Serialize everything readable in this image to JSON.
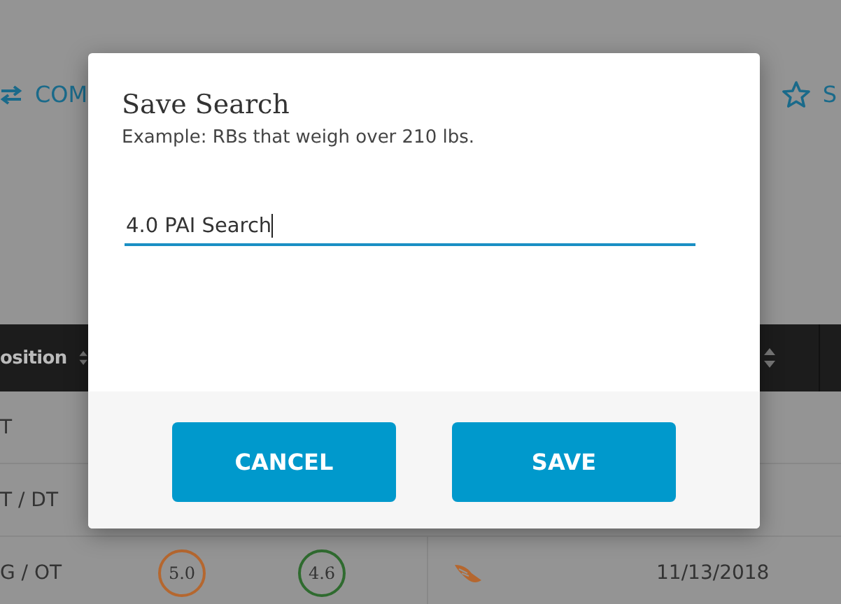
{
  "toolbar": [
    {
      "kind": "swap",
      "label": "COM"
    },
    {
      "kind": "star",
      "label": "S"
    }
  ],
  "table": {
    "columns": [
      {
        "label": "osition",
        "sortable": true
      },
      {
        "sortable": true
      }
    ],
    "rows": [
      {
        "position": "T"
      },
      {
        "position": "T / DT"
      },
      {
        "position": "G / OT",
        "scores": [
          {
            "value": "5.0",
            "color": "#b5672f"
          },
          {
            "value": "4.6",
            "color": "#2f6b2f"
          }
        ],
        "date": "11/13/2018"
      }
    ]
  },
  "dialog": {
    "title": "Save Search",
    "hint": "Example: RBs that weigh over 210 lbs.",
    "value": "4.0 PAI Search",
    "buttons": [
      "CANCEL",
      "SAVE"
    ]
  }
}
